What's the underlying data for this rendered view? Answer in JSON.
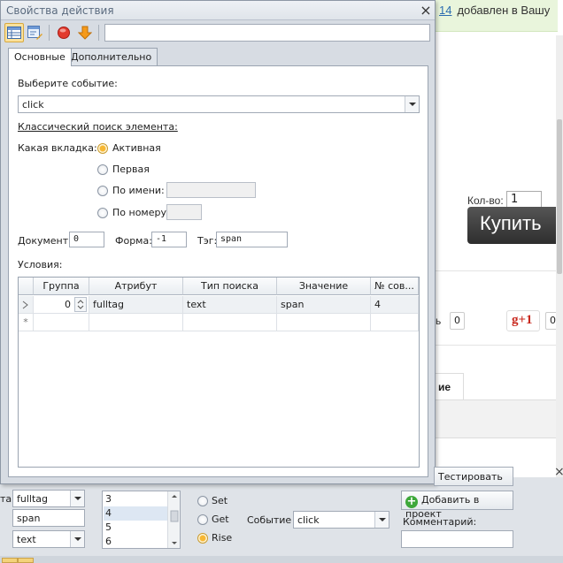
{
  "background_page": {
    "notice_number": "14",
    "notice_text": "добавлен в Вашу",
    "qty_label": "Кол-во:",
    "qty_value": "1",
    "buy_label": "Купить",
    "share_text": "ь",
    "share_count_1": "0",
    "gplus_label": "g+1",
    "share_count_2": "0",
    "tab_fragment": "ие"
  },
  "dialog": {
    "title": "Свойства действия",
    "close": "×",
    "action_name": "",
    "tabs": [
      {
        "label": "Основные",
        "active": true
      },
      {
        "label": "Дополнительно",
        "active": false
      }
    ],
    "event_label": "Выберите событие:",
    "event_value": "click",
    "classic_search_label": "Классический поиск элемента:",
    "which_tab_label": "Какая вкладка:",
    "tab_options": [
      {
        "label": "Активная",
        "selected": true
      },
      {
        "label": "Первая",
        "selected": false
      },
      {
        "label": "По имени:",
        "selected": false,
        "value": ""
      },
      {
        "label": "По номеру:",
        "selected": false,
        "value": ""
      }
    ],
    "document_label": "Документ:",
    "document_value": "0",
    "form_label": "Форма:",
    "form_value": "-1",
    "tag_label": "Тэг:",
    "tag_value": "span",
    "conditions_label": "Условия:",
    "grid": {
      "columns": [
        "Группа",
        "Атрибут",
        "Тип поиска",
        "Значение",
        "№ сов..."
      ],
      "rows": [
        {
          "group": "0",
          "attribute": "fulltag",
          "search_type": "text",
          "value": "span",
          "match_no": "4"
        }
      ],
      "new_row_marker": "*"
    }
  },
  "bottom_panel": {
    "left_cut_label": "та",
    "attr_combo": "fulltag",
    "value_field": "span",
    "type_combo": "text",
    "list_items": [
      "3",
      "4",
      "5",
      "6"
    ],
    "list_selected": "4",
    "radios": [
      {
        "label": "Set",
        "selected": false
      },
      {
        "label": "Get",
        "selected": false
      },
      {
        "label": "Rise",
        "selected": true
      }
    ],
    "event_label": "Событие",
    "event_value": "click",
    "test_button": "Тестировать",
    "add_button": "Добавить в проект",
    "comment_label": "Комментарий:",
    "comment_value": "",
    "close": "×"
  },
  "colors": {
    "dialog_bg": "#d7dce3",
    "selected_radio": "#f7b733",
    "buy_button": "#333333",
    "gplus": "#c8281e",
    "add_icon": "#3ea83b"
  }
}
